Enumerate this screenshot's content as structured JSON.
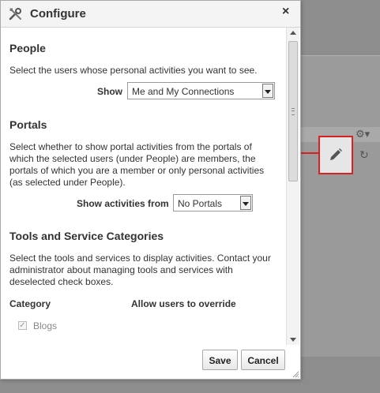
{
  "dialog": {
    "title": "Configure",
    "close_label": "×"
  },
  "people": {
    "heading": "People",
    "description": "Select the users whose personal activities you want to see.",
    "show_label": "Show",
    "show_value": "Me and My Connections"
  },
  "portals": {
    "heading": "Portals",
    "description_lines": [
      "Select whether to show portal activities from the portals of",
      "which the selected users (under People) are members, the",
      "portals of which you are a member or only personal activities",
      "(as selected under People)."
    ],
    "show_from_label": "Show activities from",
    "show_from_value": "No Portals"
  },
  "tools": {
    "heading": "Tools and Service Categories",
    "description_lines": [
      "Select the tools and services to display activities. Contact your",
      "administrator about managing tools and services with",
      "deselected check boxes."
    ],
    "col_category": "Category",
    "col_override": "Allow users to override",
    "items": [
      {
        "label": "Blogs",
        "checked": true,
        "disabled": true
      }
    ]
  },
  "footer": {
    "save_label": "Save",
    "cancel_label": "Cancel"
  },
  "icons": {
    "title": "tools-icon",
    "close": "close-icon",
    "edit": "pencil-icon",
    "settings": "gear-icon",
    "refresh": "refresh-icon"
  },
  "colors": {
    "callout": "#d6231f",
    "overlay": "#9b9b9b"
  }
}
